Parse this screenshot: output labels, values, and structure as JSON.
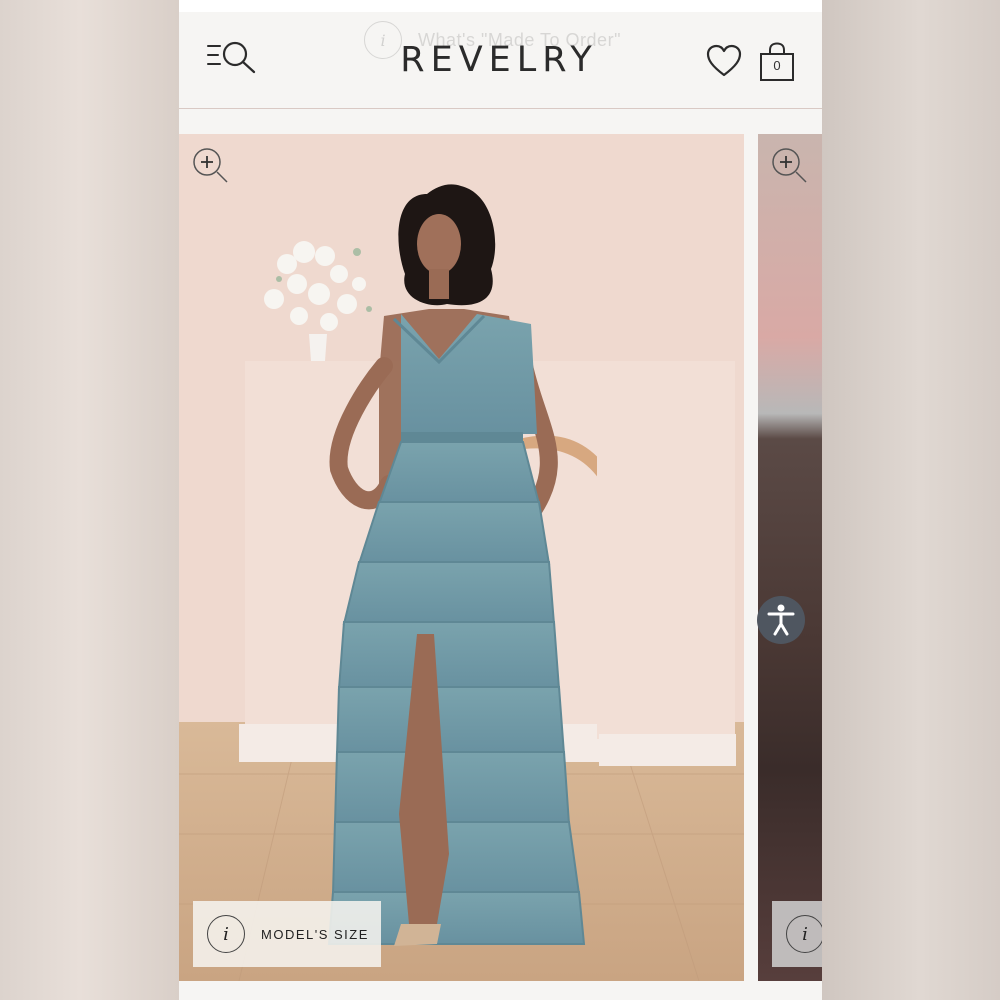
{
  "header": {
    "banner_text": "What's \"Made To Order\"",
    "banner_info_icon": "i",
    "logo": "REVELRY",
    "bag_count": "0",
    "icons": [
      "menu-icon",
      "search-icon",
      "heart-icon",
      "shopping-bag-icon"
    ]
  },
  "gallery": {
    "slides": [
      {
        "zoom_icon": "zoom-in-icon",
        "model_size_label": "MODEL'S SIZE",
        "info_icon": "i"
      },
      {
        "zoom_icon": "zoom-in-icon",
        "info_icon": "i"
      }
    ],
    "product_color": "#6f9aa5"
  },
  "accessibility_button": {
    "icon": "accessibility-icon"
  },
  "colors": {
    "header_bg": "#f6f5f3",
    "text": "#2b2b2b",
    "backdrop": "#efd9cf"
  }
}
